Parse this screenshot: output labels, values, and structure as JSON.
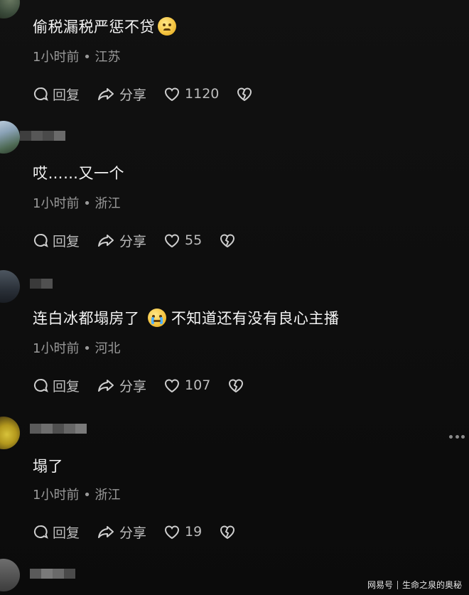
{
  "comments": [
    {
      "text": "偷税漏税严惩不贷",
      "emoji": "slightly-frowning-face",
      "time": "1小时前",
      "location": "江苏",
      "reply": "回复",
      "share": "分享",
      "likes": "1120"
    },
    {
      "text": "哎……又一个",
      "time": "1小时前",
      "location": "浙江",
      "reply": "回复",
      "share": "分享",
      "likes": "55"
    },
    {
      "text_before": "连白冰都塌房了",
      "emoji": "crying-face",
      "text_after": "不知道还有没有良心主播",
      "time": "1小时前",
      "location": "河北",
      "reply": "回复",
      "share": "分享",
      "likes": "107"
    },
    {
      "text": "塌了",
      "time": "1小时前",
      "location": "浙江",
      "reply": "回复",
      "share": "分享",
      "likes": "19"
    }
  ],
  "separator": "•",
  "watermark": {
    "left": "网易号",
    "right": "生命之泉的奥秘"
  },
  "colors": {
    "background": "#101010",
    "text": "#f4f4f4",
    "meta": "#9a9a9a",
    "action": "#bdbdbd"
  }
}
